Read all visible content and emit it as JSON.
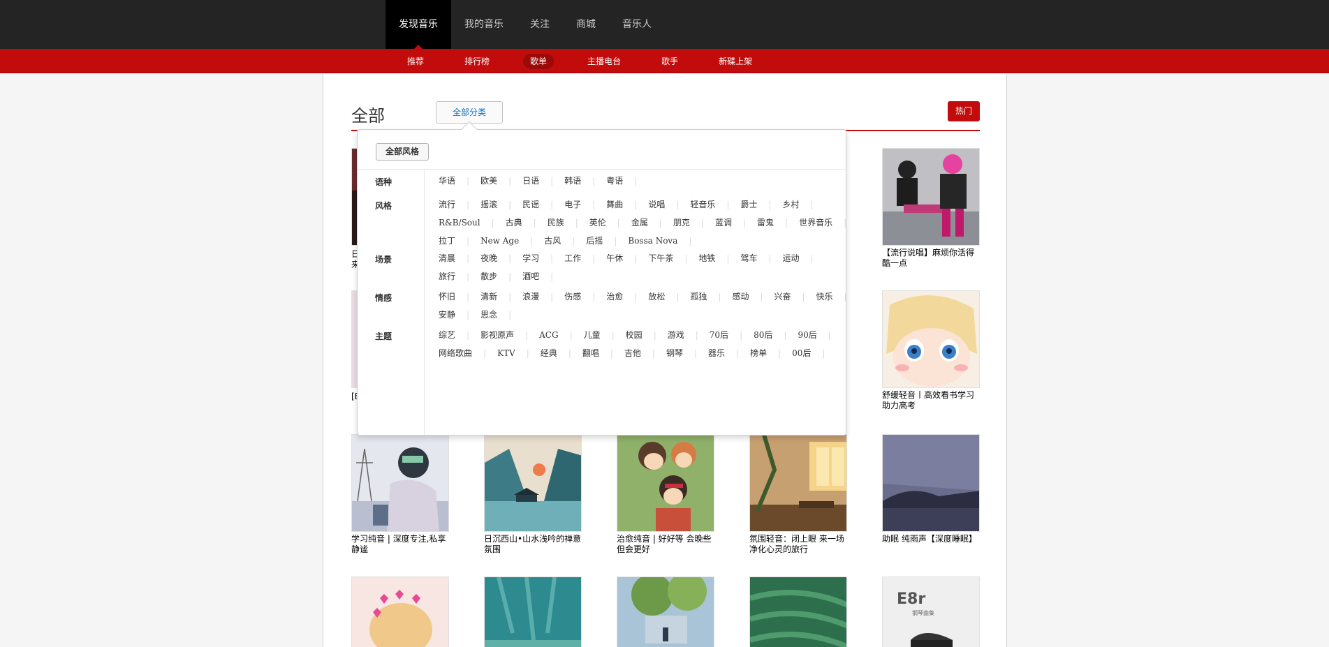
{
  "topnav": [
    "发现音乐",
    "我的音乐",
    "关注",
    "商城",
    "音乐人"
  ],
  "subnav": [
    "推荐",
    "排行榜",
    "歌单",
    "主播电台",
    "歌手",
    "新碟上架"
  ],
  "header": {
    "title": "全部",
    "category_button": "全部分类",
    "hot_button": "热门"
  },
  "popup": {
    "all_style": "全部风格",
    "categories": [
      {
        "label": "语种",
        "lines": [
          [
            "华语",
            "欧美",
            "日语",
            "韩语",
            "粤语"
          ]
        ]
      },
      {
        "label": "风格",
        "lines": [
          [
            "流行",
            "摇滚",
            "民谣",
            "电子",
            "舞曲",
            "说唱",
            "轻音乐",
            "爵士",
            "乡村"
          ],
          [
            "R&B/Soul",
            "古典",
            "民族",
            "英伦",
            "金属",
            "朋克",
            "蓝调",
            "雷鬼",
            "世界音乐"
          ],
          [
            "拉丁",
            "New Age",
            "古风",
            "后摇",
            "Bossa Nova"
          ]
        ]
      },
      {
        "label": "场景",
        "lines": [
          [
            "清晨",
            "夜晚",
            "学习",
            "工作",
            "午休",
            "下午茶",
            "地铁",
            "驾车",
            "运动"
          ],
          [
            "旅行",
            "散步",
            "酒吧"
          ]
        ]
      },
      {
        "label": "情感",
        "lines": [
          [
            "怀旧",
            "清新",
            "浪漫",
            "伤感",
            "治愈",
            "放松",
            "孤独",
            "感动",
            "兴奋",
            "快乐"
          ],
          [
            "安静",
            "思念"
          ]
        ]
      },
      {
        "label": "主题",
        "lines": [
          [
            "综艺",
            "影视原声",
            "ACG",
            "儿童",
            "校园",
            "游戏",
            "70后",
            "80后",
            "90后"
          ],
          [
            "网络歌曲",
            "KTV",
            "经典",
            "翻唱",
            "吉他",
            "钢琴",
            "器乐",
            "榜单",
            "00后"
          ]
        ]
      }
    ]
  },
  "playlists": {
    "row1_partial": {
      "title": "日\n来"
    },
    "row1_right": {
      "title": "【流行说唱】麻烦你活得酷一点"
    },
    "row2_partial": {
      "title": "[E"
    },
    "row2_right": {
      "title": "舒缓轻音丨高效看书学习助力高考"
    },
    "row3": [
      {
        "title": "学习纯音 | 深度专注,私享静谧",
        "color": "#aab2c8"
      },
      {
        "title": "日沉西山•山水浅吟的禅意氛围",
        "color": "#5d8fa8"
      },
      {
        "title": "治愈纯音 | 好好等 会晚些但会更好",
        "color": "#8fa66a"
      },
      {
        "title": "氛围轻音：闭上眼 来一场净化心灵的旅行",
        "color": "#b49a6b"
      },
      {
        "title": "助眠 纯雨声【深度睡眠】",
        "color": "#4d4f66"
      }
    ],
    "row4_cover_text": {
      "big": "E8r",
      "small": "钢琴曲集"
    }
  },
  "colors": {
    "brand_red": "#c20c0c",
    "top_bg": "#242424",
    "link_blue": "#0c73c2"
  }
}
